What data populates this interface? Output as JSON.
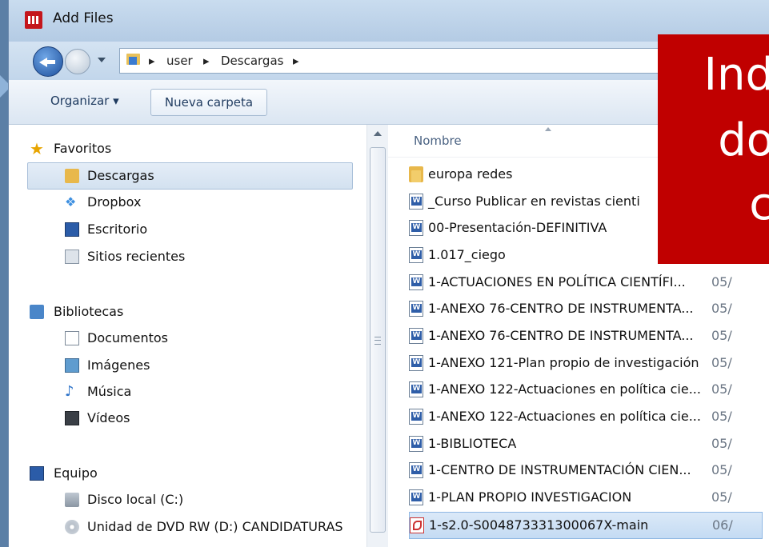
{
  "window": {
    "title": "Add Files"
  },
  "breadcrumb": [
    "user",
    "Descargas"
  ],
  "toolbar": {
    "organizar": "Organizar ▾",
    "nueva": "Nueva carpeta"
  },
  "nav": [
    {
      "label": "Favoritos",
      "icon": "star-icon"
    },
    {
      "label": "Descargas",
      "icon": "downloads-folder-icon",
      "selected": true
    },
    {
      "label": "Dropbox",
      "icon": "dropbox-icon"
    },
    {
      "label": "Escritorio",
      "icon": "desktop-icon"
    },
    {
      "label": "Sitios recientes",
      "icon": "recent-places-icon"
    },
    {
      "label": "Bibliotecas",
      "icon": "libraries-icon"
    },
    {
      "label": "Documentos",
      "icon": "documents-icon"
    },
    {
      "label": "Imágenes",
      "icon": "pictures-icon"
    },
    {
      "label": "Música",
      "icon": "music-icon"
    },
    {
      "label": "Vídeos",
      "icon": "videos-icon"
    },
    {
      "label": "Equipo",
      "icon": "computer-icon"
    },
    {
      "label": "Disco local (C:)",
      "icon": "local-disk-icon"
    },
    {
      "label": "Unidad de DVD RW (D:) CANDIDATURAS",
      "icon": "dvd-drive-icon"
    }
  ],
  "columns": {
    "nombre": "Nombre"
  },
  "files": [
    {
      "name": "europa redes",
      "date": "",
      "type": "folder"
    },
    {
      "name": "_Curso Publicar en revistas cienti",
      "date": "",
      "type": "word"
    },
    {
      "name": "00-Presentación-DEFINITIVA",
      "date": "",
      "type": "word"
    },
    {
      "name": "1.017_ciego",
      "date": "05/",
      "type": "word"
    },
    {
      "name": "1-ACTUACIONES EN POLÍTICA CIENTÍFI...",
      "date": "05/",
      "type": "word"
    },
    {
      "name": "1-ANEXO 76-CENTRO DE INSTRUMENTA...",
      "date": "05/",
      "type": "word"
    },
    {
      "name": "1-ANEXO 76-CENTRO DE INSTRUMENTA...",
      "date": "05/",
      "type": "word"
    },
    {
      "name": "1-ANEXO 121-Plan propio de investigación",
      "date": "05/",
      "type": "word"
    },
    {
      "name": "1-ANEXO 122-Actuaciones en política cie...",
      "date": "05/",
      "type": "word"
    },
    {
      "name": "1-ANEXO 122-Actuaciones en política cie...",
      "date": "05/",
      "type": "word"
    },
    {
      "name": "1-BIBLIOTECA",
      "date": "05/",
      "type": "word"
    },
    {
      "name": "1-CENTRO DE INSTRUMENTACIÓN CIEN...",
      "date": "05/",
      "type": "word"
    },
    {
      "name": "1-PLAN PROPIO INVESTIGACION",
      "date": "05/",
      "type": "word"
    },
    {
      "name": "1-s2.0-S004873331300067X-main",
      "date": "06/",
      "type": "pdf",
      "selected": true
    }
  ],
  "overlay": {
    "line1": "Ind",
    "line2": "do",
    "line3": "c"
  },
  "colors": {
    "overlay": "#c00000",
    "accent": "#1d4f9c"
  }
}
